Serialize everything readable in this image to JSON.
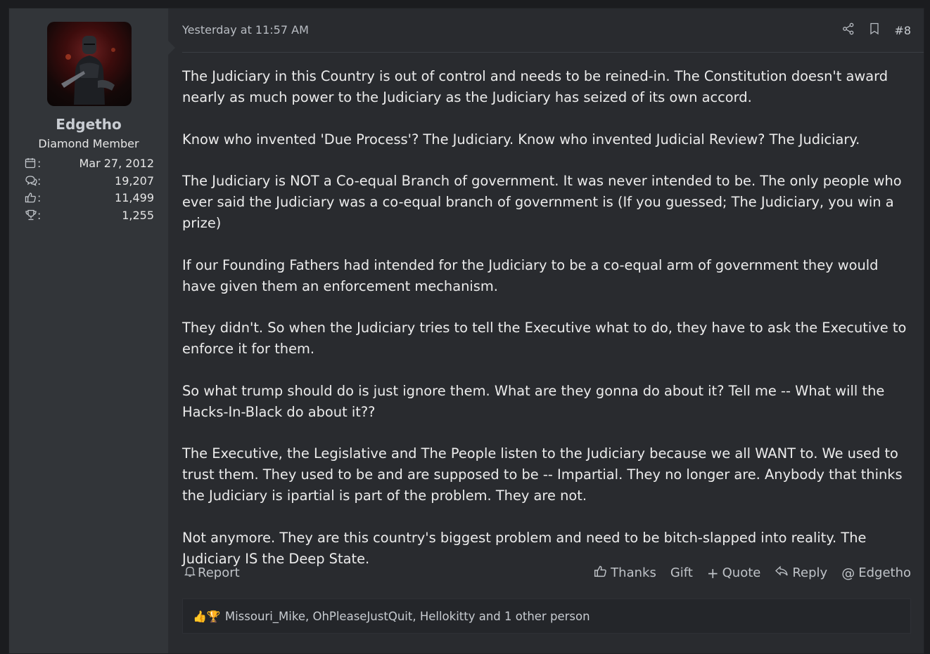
{
  "user": {
    "name": "Edgetho",
    "title": "Diamond Member",
    "stats": [
      {
        "icon": "calendar-icon",
        "value": "Mar 27, 2012"
      },
      {
        "icon": "messages-icon",
        "value": "19,207"
      },
      {
        "icon": "thumbs-up-icon",
        "value": "11,499"
      },
      {
        "icon": "trophy-icon",
        "value": "1,255"
      }
    ]
  },
  "post": {
    "timestamp": "Yesterday at 11:57 AM",
    "number": "#8",
    "paragraphs": [
      "The Judiciary in this Country is out of control and needs to be reined-in. The Constitution doesn't award nearly as much power to the Judiciary as the Judiciary has seized of its own accord.",
      "Know who invented 'Due Process'? The Judiciary. Know who invented Judicial Review? The Judiciary.",
      "The Judiciary is NOT a Co-equal Branch of government. It was never intended to be. The only people who ever said the Judiciary was a co-equal branch of government is (If you guessed; The Judiciary, you win a prize)",
      "If our Founding Fathers had intended for the Judiciary to be a co-equal arm of government they would have given them an enforcement mechanism.",
      "They didn't. So when the Judiciary tries to tell the Executive what to do, they have to ask the Executive to enforce it for them.",
      "So what trump should do is just ignore them. What are they gonna do about it? Tell me -- What will the Hacks-In-Black do about it??",
      "The Executive, the Legislative and The People listen to the Judiciary because we all WANT to. We used to trust them. They used to be and are supposed to be -- Impartial. They no longer are. Anybody that thinks the Judiciary is ipartial is part of the problem. They are not.",
      "Not anymore. They are this country's biggest problem and need to be bitch-slapped into reality. The Judiciary IS the Deep State."
    ]
  },
  "actions": {
    "report": "Report",
    "thanks": "Thanks",
    "gift": "Gift",
    "quote": "Quote",
    "reply": "Reply",
    "mention": "Edgetho"
  },
  "reactions": {
    "emoji": "👍🏆",
    "text": "Missouri_Mike, OhPleaseJustQuit, Hellokitty and 1 other person"
  }
}
